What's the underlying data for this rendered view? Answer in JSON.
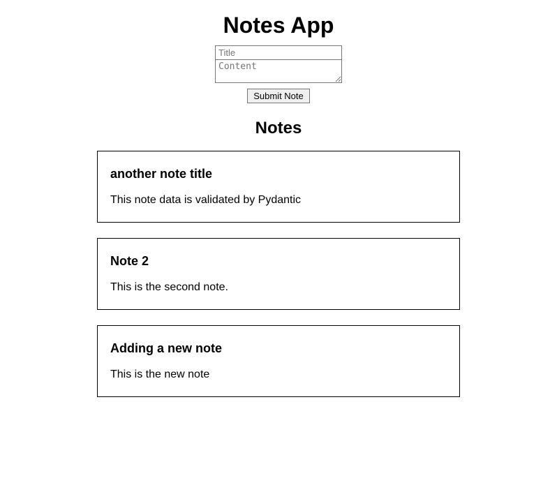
{
  "app": {
    "title": "Notes App",
    "notes_heading": "Notes"
  },
  "form": {
    "title_placeholder": "Title",
    "title_value": "",
    "content_placeholder": "Content",
    "content_value": "",
    "submit_label": "Submit Note"
  },
  "notes": [
    {
      "title": "another note title",
      "content": "This note data is validated by Pydantic"
    },
    {
      "title": "Note 2",
      "content": "This is the second note."
    },
    {
      "title": "Adding a new note",
      "content": "This is the new note"
    }
  ]
}
